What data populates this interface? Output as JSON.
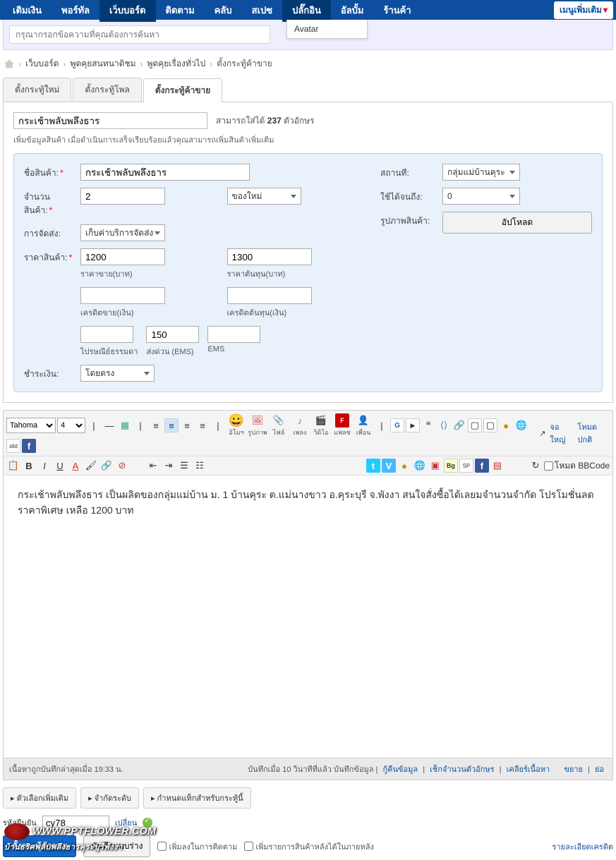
{
  "nav": {
    "items": [
      "เติมเงิน",
      "พอร์ทัล",
      "เว็บบอร์ด",
      "ติดตาม",
      "คลับ",
      "สเปซ",
      "ปลั๊กอิน",
      "อัลบั้ม",
      "ร้านค้า"
    ],
    "activeIndex": 2,
    "hoverIndex": 6,
    "dropdown": "Avatar",
    "more": "เมนูเพิ่มเติม"
  },
  "search": {
    "placeholder": "กรุณากรอกข้อความที่คุณต้องการค้นหา"
  },
  "breadcrumb": {
    "items": [
      "เว็บบอร์ด",
      "พูดคุยสนทนาดิชม",
      "พูดคุยเรื่องทั่วไป",
      "ตั้งกระทู้ค้าขาย"
    ]
  },
  "tabs": {
    "items": [
      "ตั้งกระทู้ใหม่",
      "ตั้งกระทู้โพล",
      "ตั้งกระทู้ค้าขาย"
    ],
    "activeIndex": 2
  },
  "title": {
    "value": "กระเช้าพลับพลึงธาร",
    "limit_pre": "สามารถใส่ได้ ",
    "limit_num": "237",
    "limit_post": " ตัวอักษร"
  },
  "subtext": "เพิ่มข้อมูลสินค้า เมื่อดำเนินการเสร็จเรียบร้อยแล้วคุณสามารถเพิ่มสินค้าเพิ่มเติม",
  "form": {
    "productName": {
      "label": "ชื่อสินค้า:",
      "value": "กระเช้าพลับพลึงธาร"
    },
    "qty": {
      "label": "จำนวนสินค้า:",
      "value": "2",
      "cond": "ของใหม่"
    },
    "delivery": {
      "label": "การจัดส่ง:",
      "value": "เก็บค่าบริการจัดส่ง"
    },
    "price": {
      "label": "ราคาสินค้า:",
      "sell": "1200",
      "cost": "1300",
      "sellLbl": "ราคาขาย(บาท)",
      "costLbl": "ราคาต้นทุน(บาท)",
      "creditSellLbl": "เครดิตขาย(เงิน)",
      "creditCostLbl": "เครดิตต้นทุน(เงิน)",
      "ship2": "150",
      "shipLbl1": "ไปรษณีย์ธรรมดา",
      "shipLbl2": "ส่งด่วน (EMS)",
      "shipLbl3": "EMS"
    },
    "pay": {
      "label": "ชำระเงิน:",
      "value": "โดยตรง"
    },
    "location": {
      "label": "สถานที:",
      "value": "กลุ่มแม่บ้านคุระ"
    },
    "expire": {
      "label": "ใช้ได้จนถึง:",
      "value": "0"
    },
    "image": {
      "label": "รูปภาพสินค้า:",
      "btn": "อัปโหลด"
    }
  },
  "editor": {
    "font": "Tahoma",
    "size": "4",
    "viewLarge": "จอใหญ่",
    "modeNormal": "โหมดปกติ",
    "modeBBCode": "โหมด BBCode",
    "lbls": {
      "emo": "อิโมฯ",
      "img": "รูปภาพ",
      "file": "ไฟล์",
      "music": "เพลง",
      "video": "วิดิโอ",
      "flash": "แฟลช",
      "warn": "เพื่อน"
    },
    "body": "        กระเช้าพลับพลึงธาร เป็นผลิตของกลุ่มแม่บ้าน ม. 1 บ้านคุระ ต.แม่นางขาว อ.คุระบุรี จ.พังงา  สนใจสั่งซื้อได้เลยมจำนวนจำกัด  โปรโมชั่นลดราคาพิเศษ เหลือ 1200 บาท"
  },
  "status": {
    "left": "เนื้อหาถูกบันทึกล่าสุดเมื่อ 19:33 น.",
    "save1": "บันทึกเมื่อ 10 วินาทีที่แล้ว บันทึกข้อมูล",
    "recover": "กู้คืนข้อมูล",
    "check": "เช็กจำนวนตัวอักษร",
    "clear": "เคลียร์เนื้อหา",
    "expand": "ขยาย",
    "shrink": "ย่อ"
  },
  "footer": {
    "opts": [
      "ตัวเลือกเพิ่มเติม",
      "จำกัดระดับ",
      "กำหนดแท็กสำหรับกระทู้นี้"
    ],
    "captchaLbl": "รหัสยืนยัน",
    "captchaVal": "cy78",
    "change": "เปลี่ยน",
    "submit": "ตั้งกระทู้ค้าขาย",
    "draft": "บันทึกแบบร่าง",
    "chk1": "เพิ่มลงในการติดตาม",
    "chk2": "เพิ่มรายการสินค้าหลังได้ในภายหลัง",
    "credits": "รายละเอียดเครดิต"
  },
  "watermark": {
    "url": "WWW.PPTFLOWER.COM",
    "sub": "บ้านธริศพลับพลึงธารคุระบุรีพังงา"
  }
}
